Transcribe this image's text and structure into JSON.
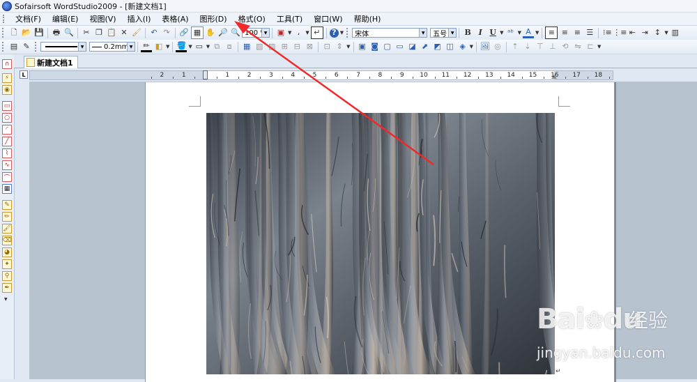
{
  "window": {
    "title": "Sofairsoft WordStudio2009 - [新建文档1]"
  },
  "menubar": {
    "items": [
      "文档(F)",
      "编辑(E)",
      "视图(V)",
      "插入(I)",
      "表格(A)",
      "图形(D)",
      "格式(O)",
      "工具(T)",
      "窗口(W)",
      "帮助(H)"
    ]
  },
  "toolbar": {
    "zoom": "100 %",
    "font_name": "宋体",
    "font_size": "五号",
    "bold": "B",
    "italic": "I",
    "underline": "U"
  },
  "drawbar": {
    "line_width": "0.2mm"
  },
  "tabs": {
    "document": "新建文档1"
  },
  "ruler": {
    "labels": [
      "2",
      "1",
      "1",
      "2",
      "3",
      "4",
      "5",
      "6",
      "7",
      "8",
      "9",
      "10",
      "11",
      "12",
      "13",
      "14",
      "15",
      "16",
      "17",
      "18"
    ]
  },
  "watermark": {
    "logo": "Bai",
    "logo_tail": "du",
    "brand": "经验",
    "url": "jingyan.baidu.com"
  },
  "colors": {
    "annotation_arrow": "#ee2a2a",
    "accent_blue": "#2b5fb5"
  },
  "icons": [
    "new-icon",
    "open-icon",
    "save-icon",
    "print-icon",
    "print-preview-icon",
    "cut-icon",
    "copy-icon",
    "paste-icon",
    "delete-icon",
    "format-painter-icon",
    "undo-icon",
    "redo-icon",
    "zoom-icon",
    "help-icon"
  ]
}
